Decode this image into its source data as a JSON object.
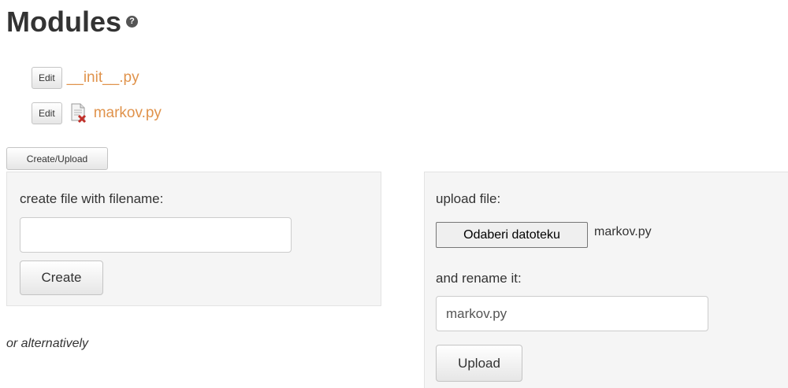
{
  "header": {
    "title": "Modules",
    "help_icon": "question-circle-icon"
  },
  "files": [
    {
      "edit_label": "Edit",
      "name": "__init__.py",
      "icon": null
    },
    {
      "edit_label": "Edit",
      "name": "markov.py",
      "icon": "document-delete-icon"
    }
  ],
  "toolbar": {
    "create_upload_label": "Create/Upload"
  },
  "create_panel": {
    "filename_label": "create file with filename:",
    "filename_value": "",
    "create_button": "Create"
  },
  "alternatively_text": "or alternatively",
  "upload_panel": {
    "upload_label": "upload file:",
    "choose_button": "Odaberi datoteku",
    "chosen_file": "markov.py",
    "rename_label": "and rename it:",
    "rename_value": "markov.py",
    "upload_button": "Upload"
  },
  "colors": {
    "link": "#e0934c",
    "panel_bg": "#f5f5f5",
    "delete_icon": "#c0302a"
  }
}
